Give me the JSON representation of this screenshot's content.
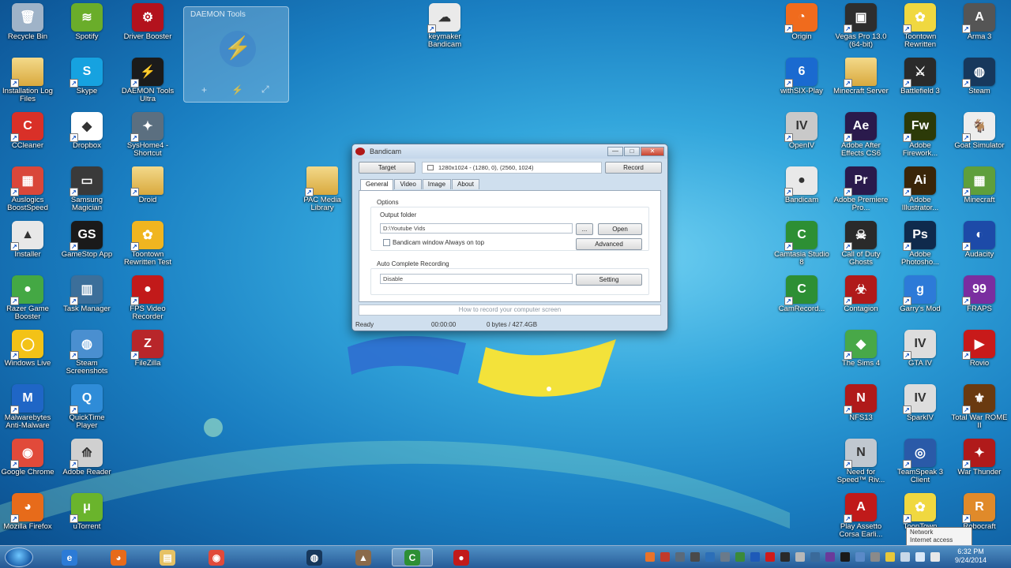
{
  "desktop_icons": [
    {
      "label": "Recycle Bin",
      "icon": "recycle-bin-icon",
      "color": "#9fb3c8",
      "glyph": "🗑"
    },
    {
      "label": "Spotify",
      "icon": "spotify-icon",
      "color": "#6aad2a",
      "glyph": "≋"
    },
    {
      "label": "Driver Booster",
      "icon": "driver-booster-icon",
      "color": "#b3121d",
      "glyph": "⚙"
    },
    {
      "label": "Installation Log Files",
      "icon": "folder-icon",
      "color": "#e6c265",
      "glyph": ""
    },
    {
      "label": "Skype",
      "icon": "skype-icon",
      "color": "#16a2e0",
      "glyph": "S"
    },
    {
      "label": "DAEMON Tools Ultra",
      "icon": "daemon-tools-icon",
      "color": "#1b1b1b",
      "glyph": "⚡"
    },
    {
      "label": "CCleaner",
      "icon": "ccleaner-icon",
      "color": "#d93028",
      "glyph": "C"
    },
    {
      "label": "Dropbox",
      "icon": "dropbox-icon",
      "color": "#ffffff",
      "glyph": "◆"
    },
    {
      "label": "SysHome4 - Shortcut",
      "icon": "system-tool-icon",
      "color": "#5b6f80",
      "glyph": "✦"
    },
    {
      "label": "Auslogics BoostSpeed",
      "icon": "auslogics-icon",
      "color": "#d9473a",
      "glyph": "▦"
    },
    {
      "label": "Samsung Magician",
      "icon": "samsung-magician-icon",
      "color": "#3a3a3a",
      "glyph": "▭"
    },
    {
      "label": "Droid",
      "icon": "folder-icon",
      "color": "#e6c265",
      "glyph": ""
    },
    {
      "label": "Installer",
      "icon": "installer-icon",
      "color": "#e8e8e8",
      "glyph": "▲"
    },
    {
      "label": "GameStop App",
      "icon": "gamestop-icon",
      "color": "#1a1a1a",
      "glyph": "GS"
    },
    {
      "label": "Toontown Rewritten Test",
      "icon": "toontown-icon",
      "color": "#f0b520",
      "glyph": "✿"
    },
    {
      "label": "Razer Game Booster",
      "icon": "game-booster-icon",
      "color": "#44a844",
      "glyph": "●"
    },
    {
      "label": "Task Manager",
      "icon": "task-manager-icon",
      "color": "#3c6f9a",
      "glyph": "▥"
    },
    {
      "label": "FPS Video Recorder",
      "icon": "recorder-icon",
      "color": "#c21a1a",
      "glyph": "●"
    },
    {
      "label": "Windows Live",
      "icon": "windows-live-icon",
      "color": "#f3c217",
      "glyph": "◯"
    },
    {
      "label": "Steam Screenshots",
      "icon": "steam-tool-icon",
      "color": "#4a8fd0",
      "glyph": "◍"
    },
    {
      "label": "FileZilla",
      "icon": "filezilla-icon",
      "color": "#b8262a",
      "glyph": "Z"
    },
    {
      "label": "Malwarebytes Anti-Malware",
      "icon": "malwarebytes-icon",
      "color": "#1f66c6",
      "glyph": "M"
    },
    {
      "label": "QuickTime Player",
      "icon": "quicktime-icon",
      "color": "#2f8cd8",
      "glyph": "Q"
    },
    {
      "label": "Google Chrome",
      "icon": "chrome-icon",
      "color": "#e14a3a",
      "glyph": "◉"
    },
    {
      "label": "Adobe Reader",
      "icon": "adobe-reader-icon",
      "color": "#d0d0d0",
      "glyph": "⟰"
    },
    {
      "label": "Mozilla Firefox",
      "icon": "firefox-icon",
      "color": "#e76b1a",
      "glyph": "◕"
    },
    {
      "label": "uTorrent",
      "icon": "utorrent-icon",
      "color": "#6ab42c",
      "glyph": "μ"
    },
    {
      "label": "keymaker Bandicam",
      "icon": "keymaker-icon",
      "color": "#eaeaea",
      "glyph": "☁"
    },
    {
      "label": "PAC Media Library",
      "icon": "folder-icon",
      "color": "#e6c265",
      "glyph": ""
    },
    {
      "label": "Origin",
      "icon": "origin-icon",
      "color": "#f06b1d",
      "glyph": "◔"
    },
    {
      "label": "Vegas Pro 13.0 (64-bit)",
      "icon": "vegas-pro-icon",
      "color": "#2e2e2e",
      "glyph": "▣"
    },
    {
      "label": "Toontown Rewritten",
      "icon": "toontown-icon",
      "color": "#f0d840",
      "glyph": "✿"
    },
    {
      "label": "Arma 3",
      "icon": "arma-icon",
      "color": "#555555",
      "glyph": "A"
    },
    {
      "label": "withSIX-Play",
      "icon": "withsix-icon",
      "color": "#1a6ad0",
      "glyph": "6"
    },
    {
      "label": "Minecraft Server",
      "icon": "folder-icon",
      "color": "#e6c265",
      "glyph": ""
    },
    {
      "label": "Battlefield 3",
      "icon": "battlefield-icon",
      "color": "#2a2a2a",
      "glyph": "⚔"
    },
    {
      "label": "Steam",
      "icon": "steam-icon",
      "color": "#17385c",
      "glyph": "◍"
    },
    {
      "label": "OpenIV",
      "icon": "openiv-icon",
      "color": "#c9c9c9",
      "glyph": "IV"
    },
    {
      "label": "Adobe After Effects CS6",
      "icon": "after-effects-icon",
      "color": "#2a1a4c",
      "glyph": "Ae"
    },
    {
      "label": "Adobe Firework...",
      "icon": "fireworks-icon",
      "color": "#2c3a08",
      "glyph": "Fw"
    },
    {
      "label": "Goat Simulator",
      "icon": "goat-simulator-icon",
      "color": "#ededed",
      "glyph": "🐐"
    },
    {
      "label": "Bandicam",
      "icon": "bandicam-icon",
      "color": "#e9e9e9",
      "glyph": "●"
    },
    {
      "label": "Adobe Premiere Pro...",
      "icon": "premiere-icon",
      "color": "#2a1a4c",
      "glyph": "Pr"
    },
    {
      "label": "Adobe Illustrator...",
      "icon": "illustrator-icon",
      "color": "#3a2508",
      "glyph": "Ai"
    },
    {
      "label": "Minecraft",
      "icon": "minecraft-icon",
      "color": "#5f9f3c",
      "glyph": "▦"
    },
    {
      "label": "Camtasia Studio 8",
      "icon": "camtasia-icon",
      "color": "#2d8f34",
      "glyph": "C"
    },
    {
      "label": "Call of Duty Ghosts",
      "icon": "call-of-duty-icon",
      "color": "#2a2a2a",
      "glyph": "☠"
    },
    {
      "label": "Adobe Photosho...",
      "icon": "photoshop-icon",
      "color": "#0f2a4c",
      "glyph": "Ps"
    },
    {
      "label": "Audacity",
      "icon": "audacity-icon",
      "color": "#1d4aa8",
      "glyph": "◐"
    },
    {
      "label": "CamRecord...",
      "icon": "camrecorder-icon",
      "color": "#2d8f34",
      "glyph": "C"
    },
    {
      "label": "Contagion",
      "icon": "contagion-icon",
      "color": "#b01a1a",
      "glyph": "☣"
    },
    {
      "label": "Garry's Mod",
      "icon": "garrys-mod-icon",
      "color": "#2d7ad8",
      "glyph": "g"
    },
    {
      "label": "FRAPS",
      "icon": "fraps-icon",
      "color": "#7a2ea0",
      "glyph": "99"
    },
    {
      "label": "The Sims 4",
      "icon": "sims-icon",
      "color": "#48a848",
      "glyph": "◆"
    },
    {
      "label": "GTA IV",
      "icon": "gta-iv-icon",
      "color": "#dddddd",
      "glyph": "IV"
    },
    {
      "label": "Rovio",
      "icon": "rovio-icon",
      "color": "#c81a1a",
      "glyph": "▶"
    },
    {
      "label": "NFS13",
      "icon": "nfs-icon",
      "color": "#b01a1a",
      "glyph": "N"
    },
    {
      "label": "SparkIV",
      "icon": "sparkiv-icon",
      "color": "#dddddd",
      "glyph": "IV"
    },
    {
      "label": "Total War ROME II",
      "icon": "total-war-icon",
      "color": "#6a3a10",
      "glyph": "⚜"
    },
    {
      "label": "Need for Speed™ Riv...",
      "icon": "need-for-speed-icon",
      "color": "#c0c8d0",
      "glyph": "N"
    },
    {
      "label": "TeamSpeak 3 Client",
      "icon": "teamspeak-icon",
      "color": "#2a5aa8",
      "glyph": "◎"
    },
    {
      "label": "War Thunder",
      "icon": "war-thunder-icon",
      "color": "#b01a1a",
      "glyph": "✦"
    },
    {
      "label": "Play Assetto Corsa Earli...",
      "icon": "assetto-corsa-icon",
      "color": "#c01a1a",
      "glyph": "A"
    },
    {
      "label": "ToonTown",
      "icon": "toontown-icon",
      "color": "#f0d840",
      "glyph": "✿"
    },
    {
      "label": "Robocraft",
      "icon": "robocraft-icon",
      "color": "#e08a2a",
      "glyph": "R"
    }
  ],
  "gadget": {
    "title": "DAEMON Tools",
    "add": "+",
    "settings": "⚡",
    "tools": "⤢"
  },
  "bandicam": {
    "title": "Bandicam",
    "minimize": "—",
    "maximize": "□",
    "close": "✕",
    "target_label": "Target",
    "resolution": "1280x1024 - (1280, 0), (2560, 1024)",
    "record_label": "Record",
    "tabs": [
      "General",
      "Video",
      "Image",
      "About"
    ],
    "options_label": "Options",
    "output_folder_label": "Output folder",
    "output_folder_value": "D:\\Youtube Vids",
    "browse_label": "...",
    "open_label": "Open",
    "always_on_top_label": "Bandicam window Always on top",
    "advanced_label": "Advanced",
    "auto_complete_label": "Auto Complete Recording",
    "auto_complete_value": "Disable",
    "setting_label": "Setting",
    "howto_text": "How to record your computer screen",
    "status": "Ready",
    "time": "00:00:00",
    "size": "0 bytes / 427.4GB"
  },
  "taskbar": {
    "items": [
      {
        "icon": "internet-explorer-icon",
        "color": "#2c7bd6",
        "glyph": "e"
      },
      {
        "icon": "firefox-icon",
        "color": "#e76b1a",
        "glyph": "◕"
      },
      {
        "icon": "file-explorer-icon",
        "color": "#e6c265",
        "glyph": "▤"
      },
      {
        "icon": "chrome-icon",
        "color": "#e14a3a",
        "glyph": "◉"
      },
      {
        "icon": "steam-icon",
        "color": "#17385c",
        "glyph": "◍"
      },
      {
        "icon": "app-icon",
        "color": "#8a6a4a",
        "glyph": "▲"
      },
      {
        "icon": "camtasia-icon",
        "color": "#2d8f34",
        "glyph": "C"
      },
      {
        "icon": "bandicam-icon",
        "color": "#c21a1a",
        "glyph": "●"
      }
    ],
    "active_index": 6,
    "clock_time": "6:32 PM",
    "clock_date": "9/24/2014",
    "network_tooltip_line1": "Network",
    "network_tooltip_line2": "Internet access"
  }
}
